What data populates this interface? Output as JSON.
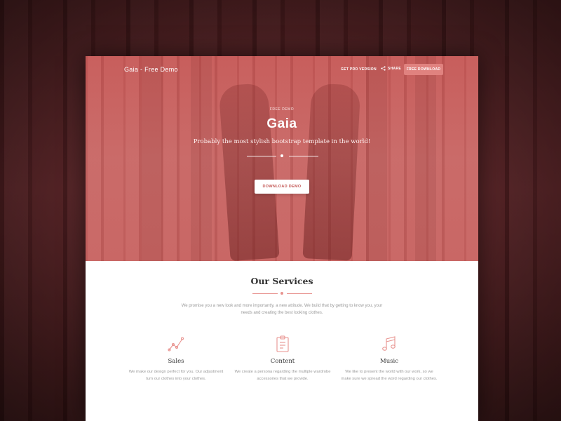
{
  "nav": {
    "brand": "Gaia - Free Demo",
    "pro_label": "GET PRO VERSION",
    "share_label": "SHARE",
    "download_label": "FREE DOWNLOAD"
  },
  "hero": {
    "kicker": "FREE DEMO",
    "title": "Gaia",
    "tagline": "Probably the most stylish bootstrap template in the world!",
    "cta_label": "DOWNLOAD DEMO"
  },
  "services": {
    "title": "Our Services",
    "intro": "We promise you a new look and more importantly, a new attitude. We build that by getting to know you, your needs and creating the best looking clothes.",
    "items": [
      {
        "icon": "chart-line-icon",
        "name": "Sales",
        "text": "We make our design perfect for you. Our adjustment turn our clothes into your clothes."
      },
      {
        "icon": "clipboard-icon",
        "name": "Content",
        "text": "We create a persona regarding the multiple wardrobe accessories that we provide."
      },
      {
        "icon": "music-note-icon",
        "name": "Music",
        "text": "We like to present the world with our work, so we make sure we spread the word regarding our clothes."
      }
    ]
  },
  "colors": {
    "accent": "#e8938f",
    "hero_overlay": "#c96866",
    "background": "#4a1c1e"
  }
}
